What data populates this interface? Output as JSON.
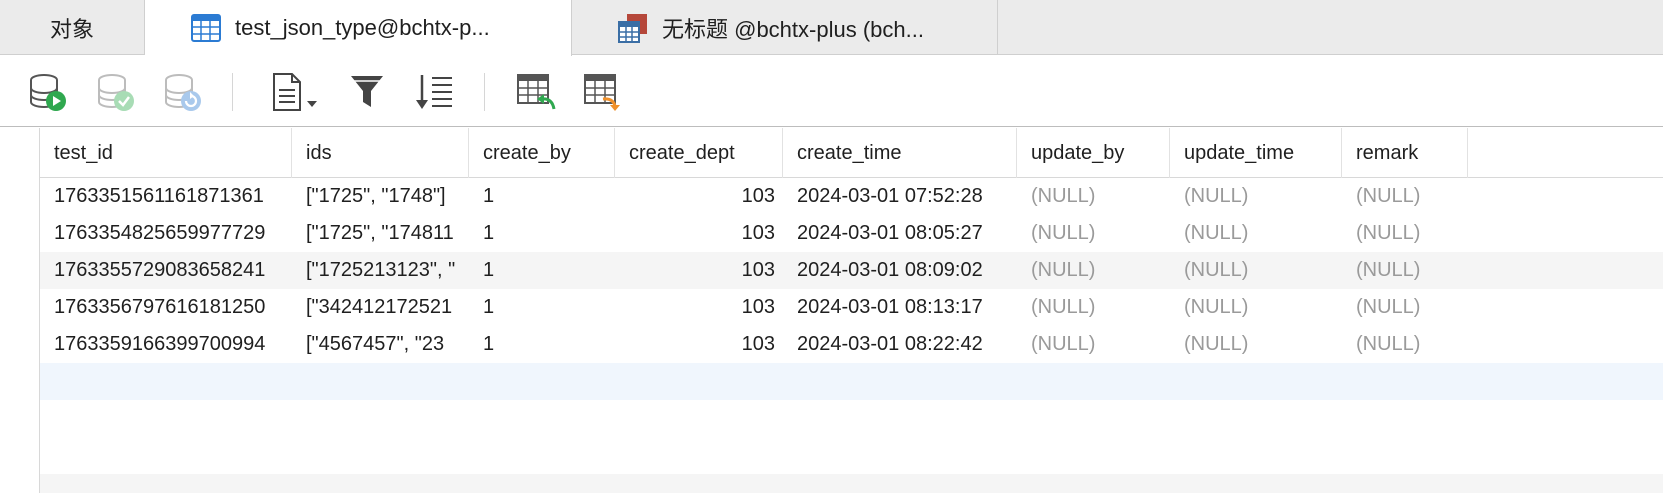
{
  "tabs": [
    {
      "label": "对象"
    },
    {
      "label": "test_json_type@bchtx-p..."
    },
    {
      "label": "无标题 @bchtx-plus (bch..."
    }
  ],
  "colors": {
    "accent": "#2b7bd3",
    "null_text": "#9a9a9a",
    "run_green": "#2fa84f",
    "orange": "#f0902a"
  },
  "toolbar": {
    "icons": [
      "run-database-icon",
      "apply-database-icon",
      "refresh-database-icon",
      "text-document-icon",
      "filter-icon",
      "sort-icon",
      "import-table-icon",
      "export-table-icon"
    ]
  },
  "table": {
    "columns": [
      "test_id",
      "ids",
      "create_by",
      "create_dept",
      "create_time",
      "update_by",
      "update_time",
      "remark"
    ],
    "rows": [
      [
        "1763351561161871361",
        "[\"1725\", \"1748\"]",
        "1",
        "103",
        "2024-03-01 07:52:28",
        "(NULL)",
        "(NULL)",
        "(NULL)"
      ],
      [
        "1763354825659977729",
        "[\"1725\", \"174811",
        "1",
        "103",
        "2024-03-01 08:05:27",
        "(NULL)",
        "(NULL)",
        "(NULL)"
      ],
      [
        "1763355729083658241",
        "[\"1725213123\", \"",
        "1",
        "103",
        "2024-03-01 08:09:02",
        "(NULL)",
        "(NULL)",
        "(NULL)"
      ],
      [
        "1763356797616181250",
        "[\"342412172521",
        "1",
        "103",
        "2024-03-01 08:13:17",
        "(NULL)",
        "(NULL)",
        "(NULL)"
      ],
      [
        "1763359166399700994",
        "[\"4567457\", \"23",
        "1",
        "103",
        "2024-03-01 08:22:42",
        "(NULL)",
        "(NULL)",
        "(NULL)"
      ]
    ]
  }
}
